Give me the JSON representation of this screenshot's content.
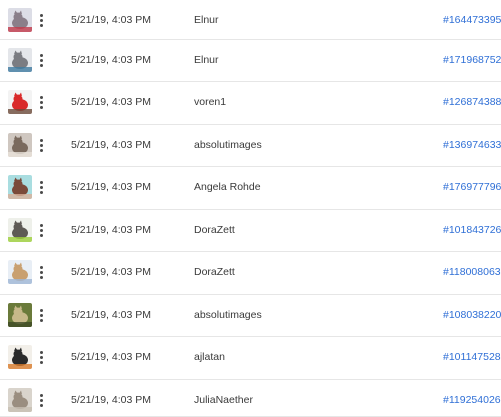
{
  "rows": [
    {
      "thumbnail": "cat-photo-thumbnail",
      "date": "5/21/19, 4:03 PM",
      "author": "Elnur",
      "id": "#164473395",
      "colors": [
        "#dcdde6",
        "#8a7f8a",
        "#c23a4a"
      ]
    },
    {
      "thumbnail": "cat-photo-thumbnail",
      "date": "5/21/19, 4:03 PM",
      "author": "Elnur",
      "id": "#171968752",
      "colors": [
        "#e4e6ea",
        "#7b7c82",
        "#3f7aa0"
      ]
    },
    {
      "thumbnail": "cat-photo-thumbnail",
      "date": "5/21/19, 4:03 PM",
      "author": "voren1",
      "id": "#126874388",
      "colors": [
        "#f3f3f3",
        "#d92a2a",
        "#6b4a3a"
      ]
    },
    {
      "thumbnail": "cat-photo-thumbnail",
      "date": "5/21/19, 4:03 PM",
      "author": "absolutimages",
      "id": "#136974633",
      "colors": [
        "#cfc7c0",
        "#7a6a5e",
        "#e9e2da"
      ]
    },
    {
      "thumbnail": "cat-photo-thumbnail",
      "date": "5/21/19, 4:03 PM",
      "author": "Angela Rohde",
      "id": "#176977796",
      "colors": [
        "#a9dde0",
        "#7a4a3a",
        "#d9b09a"
      ]
    },
    {
      "thumbnail": "cat-photo-thumbnail",
      "date": "5/21/19, 4:03 PM",
      "author": "DoraZett",
      "id": "#101843726",
      "colors": [
        "#eef0ea",
        "#5e5a55",
        "#9ccf3a"
      ]
    },
    {
      "thumbnail": "cat-photo-thumbnail",
      "date": "5/21/19, 4:03 PM",
      "author": "DoraZett",
      "id": "#118008063",
      "colors": [
        "#e8eef5",
        "#c9a070",
        "#9fb6d6"
      ]
    },
    {
      "thumbnail": "cat-photo-thumbnail",
      "date": "5/21/19, 4:03 PM",
      "author": "absolutimages",
      "id": "#108038220",
      "colors": [
        "#6a7a3a",
        "#c7b98a",
        "#3e4a25"
      ]
    },
    {
      "thumbnail": "cat-photo-thumbnail",
      "date": "5/21/19, 4:03 PM",
      "author": "ajlatan",
      "id": "#101147528",
      "colors": [
        "#f2efe9",
        "#2a2a2a",
        "#d87a2a"
      ]
    },
    {
      "thumbnail": "cat-photo-thumbnail",
      "date": "5/21/19, 4:03 PM",
      "author": "JuliaNaether",
      "id": "#119254026",
      "colors": [
        "#d9d4cc",
        "#9a8e80",
        "#c7bfb3"
      ]
    }
  ],
  "icons": {
    "more": "more-vertical-icon"
  }
}
